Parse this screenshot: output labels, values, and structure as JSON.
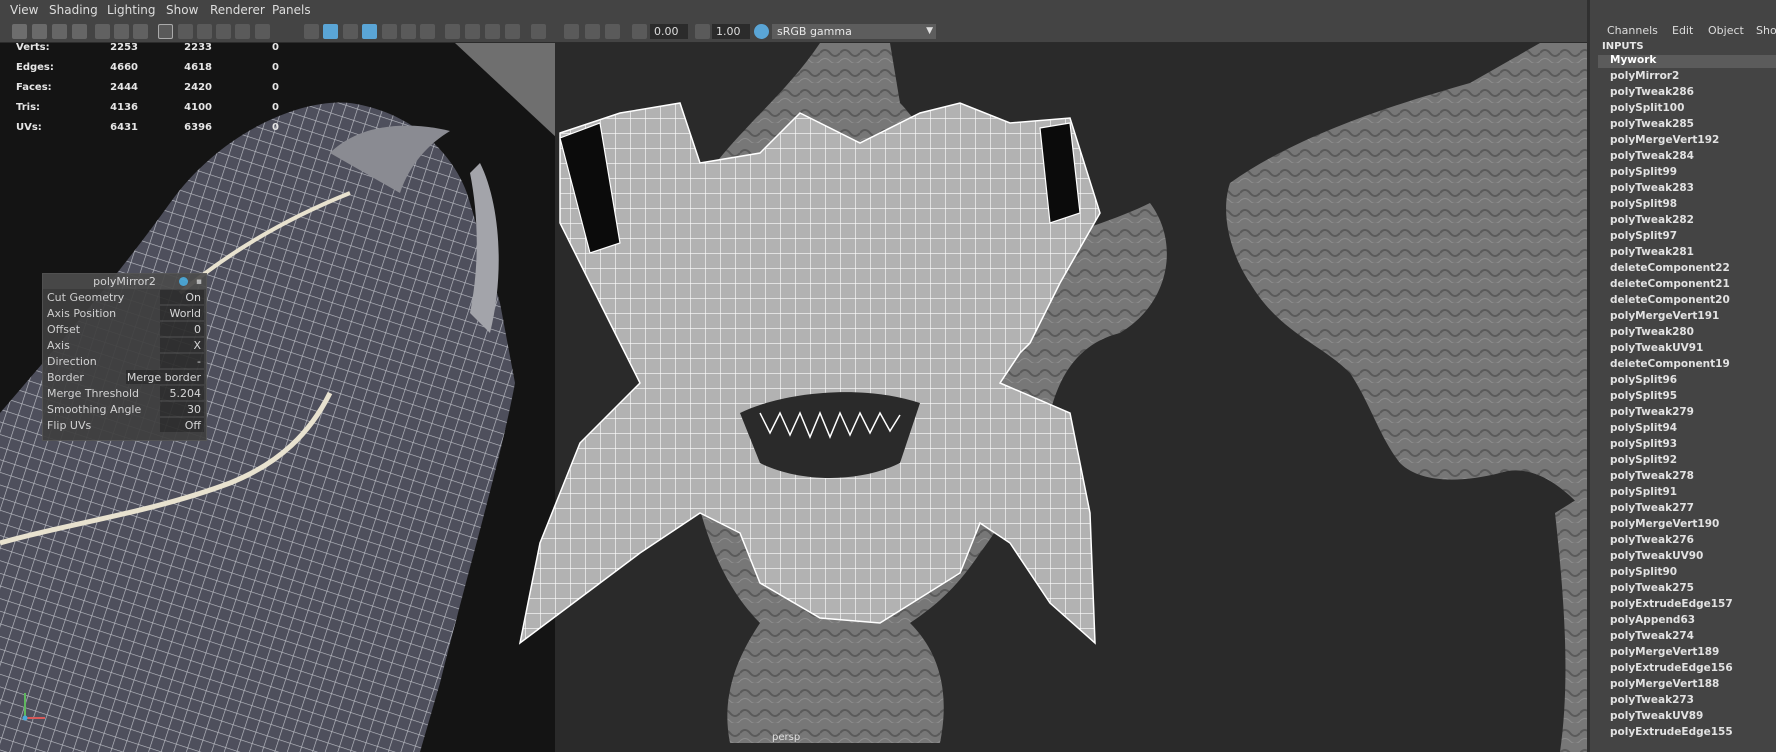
{
  "menubar": [
    "View",
    "Shading",
    "Lighting",
    "Show",
    "Renderer",
    "Panels"
  ],
  "toolbar": {
    "exposure_value": "0.00",
    "gamma_value": "1.00",
    "color_management": "sRGB gamma",
    "colors": {
      "accent": "#5aa5d6",
      "toolbar_bg": "#444444"
    }
  },
  "hud": {
    "rows": [
      {
        "label": "Verts:",
        "v1": "2253",
        "v2": "2233",
        "v3": "0"
      },
      {
        "label": "Edges:",
        "v1": "4660",
        "v2": "4618",
        "v3": "0"
      },
      {
        "label": "Faces:",
        "v1": "2444",
        "v2": "2420",
        "v3": "0"
      },
      {
        "label": "Tris:",
        "v1": "4136",
        "v2": "4100",
        "v3": "0"
      },
      {
        "label": "UVs:",
        "v1": "6431",
        "v2": "6396",
        "v3": "0"
      }
    ]
  },
  "poly_mirror": {
    "title": "polyMirror2",
    "rows": [
      {
        "label": "Cut Geometry",
        "value": "On"
      },
      {
        "label": "Axis Position",
        "value": "World"
      },
      {
        "label": "Offset",
        "value": "0"
      },
      {
        "label": "Axis",
        "value": "X"
      },
      {
        "label": "Direction",
        "value": "-"
      },
      {
        "label": "Border",
        "value": "Merge border"
      },
      {
        "label": "Merge Threshold",
        "value": "5.204"
      },
      {
        "label": "Smoothing Angle",
        "value": "30"
      },
      {
        "label": "Flip UVs",
        "value": "Off"
      }
    ]
  },
  "viewport": {
    "camera": "persp"
  },
  "channel_box": {
    "menu": [
      "Channels",
      "Edit",
      "Object",
      "Show"
    ],
    "inputs_label": "INPUTS",
    "items": [
      "Mywork",
      "polyMirror2",
      "polyTweak286",
      "polySplit100",
      "polyTweak285",
      "polyMergeVert192",
      "polyTweak284",
      "polySplit99",
      "polyTweak283",
      "polySplit98",
      "polyTweak282",
      "polySplit97",
      "polyTweak281",
      "deleteComponent22",
      "deleteComponent21",
      "deleteComponent20",
      "polyMergeVert191",
      "polyTweak280",
      "polyTweakUV91",
      "deleteComponent19",
      "polySplit96",
      "polySplit95",
      "polyTweak279",
      "polySplit94",
      "polySplit93",
      "polySplit92",
      "polyTweak278",
      "polySplit91",
      "polyTweak277",
      "polyMergeVert190",
      "polyTweak276",
      "polyTweakUV90",
      "polySplit90",
      "polyTweak275",
      "polyExtrudeEdge157",
      "polyAppend63",
      "polyTweak274",
      "polyMergeVert189",
      "polyExtrudeEdge156",
      "polyMergeVert188",
      "polyTweak273",
      "polyTweakUV89",
      "polyExtrudeEdge155"
    ]
  }
}
